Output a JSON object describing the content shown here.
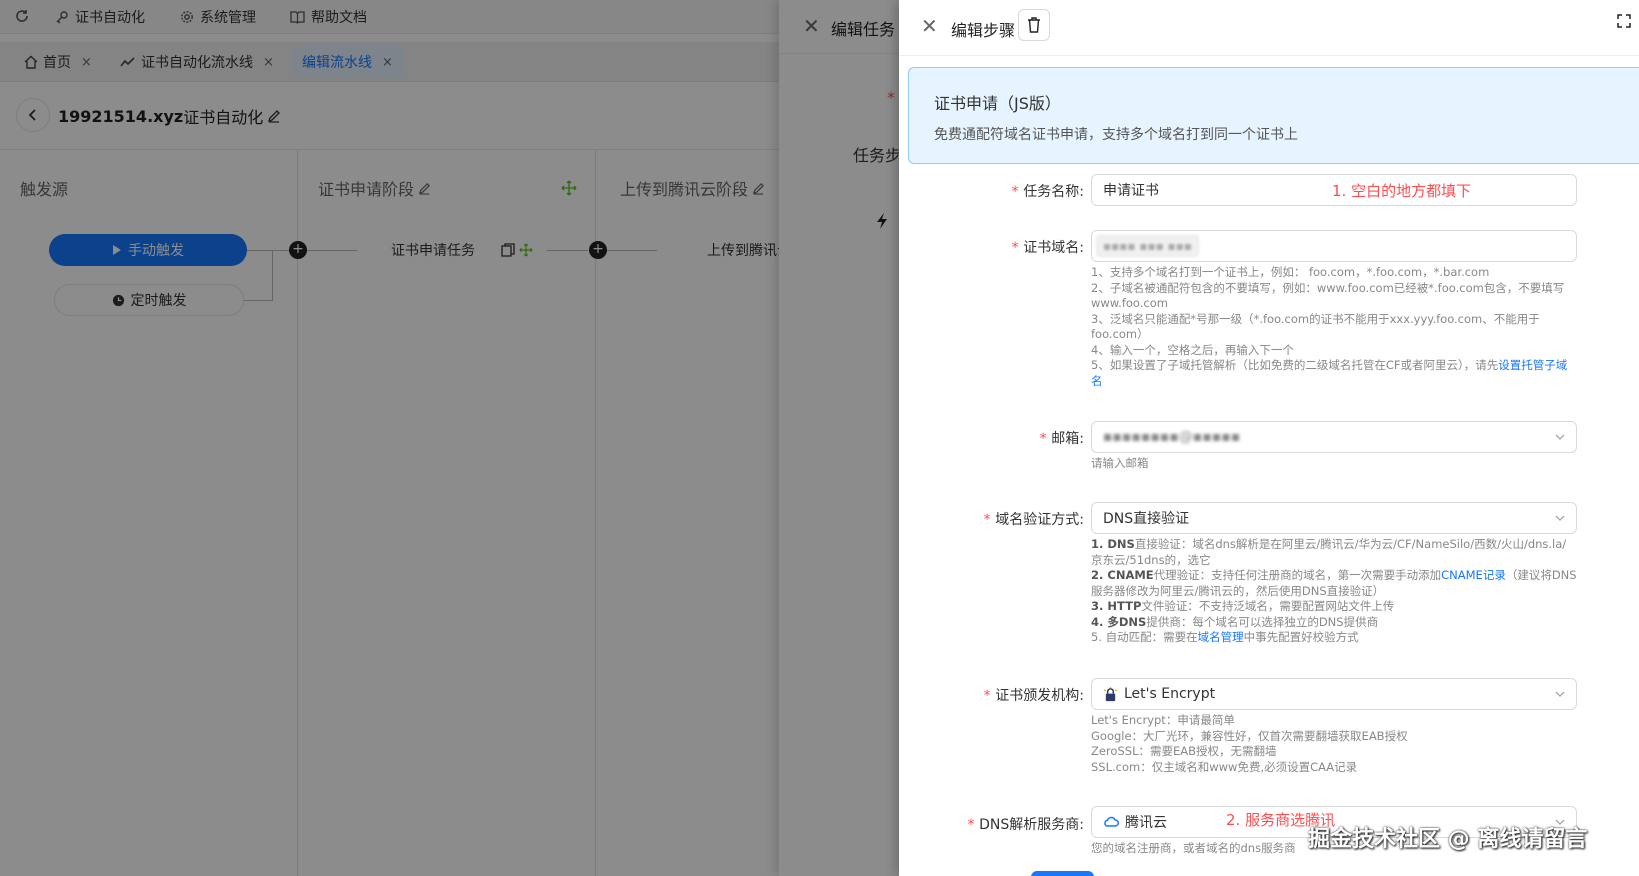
{
  "topnav": {
    "items": [
      {
        "label": "证书自动化",
        "icon": "key-icon"
      },
      {
        "label": "系统管理",
        "icon": "gear-icon"
      },
      {
        "label": "帮助文档",
        "icon": "book-icon"
      }
    ]
  },
  "tabs": [
    {
      "label": "首页",
      "close": "×"
    },
    {
      "label": "证书自动化流水线",
      "close": "×"
    },
    {
      "label": "编辑流水线",
      "close": "×"
    }
  ],
  "page": {
    "title_id": "19921514.xyz",
    "title_suffix": "证书自动化"
  },
  "pipeline": {
    "stages": [
      {
        "title": "触发源"
      },
      {
        "title": "证书申请阶段"
      },
      {
        "title": "上传到腾讯云阶段"
      }
    ],
    "triggers": {
      "manual": "手动触发",
      "scheduled": "定时触发"
    },
    "tasks": {
      "cert_task": "证书申请任务",
      "upload_task": "上传到腾讯云"
    }
  },
  "drawer_task": {
    "title": "编辑任务",
    "label": "任务步",
    "star": "*"
  },
  "drawer_step": {
    "title": "编辑步骤",
    "plugin": {
      "title": "证书申请（JS版）",
      "description": "免费通配符域名证书申请，支持多个域名打到同一个证书上"
    },
    "fields": {
      "task_name": {
        "label": "任务名称:",
        "value": "申请证书",
        "annotation": "1. 空白的地方都填下"
      },
      "domains": {
        "label": "证书域名:",
        "value": "▪▪▪▪ ▪▪▪ ▪▪▪",
        "help": [
          "1、支持多个域名打到一个证书上，例如： foo.com，*.foo.com，*.bar.com",
          "2、子域名被通配符包含的不要填写，例如：www.foo.com已经被*.foo.com包含，不要填写www.foo.com",
          "3、泛域名只能通配*号那一级（*.foo.com的证书不能用于xxx.yyy.foo.com、不能用于foo.com）",
          "4、输入一个，空格之后，再输入下一个"
        ],
        "help5_prefix": "5、如果设置了子域托管解析（比如免费的二级域名托管在CF或者阿里云），请先",
        "help5_link": "设置托管子域名"
      },
      "email": {
        "label": "邮箱:",
        "value": "▪▪▪▪▪▪▪▪@▪▪▪▪▪",
        "help": "请输入邮箱"
      },
      "verify": {
        "label": "域名验证方式:",
        "value": "DNS直接验证",
        "help": [
          {
            "b": "1. DNS",
            "t": "直接验证：域名dns解析是在阿里云/腾讯云/华为云/CF/NameSilo/西数/火山/dns.la/京东云/51dns的，选它"
          },
          {
            "b": "2. CNAME",
            "t": "代理验证：支持任何注册商的域名，第一次需要手动添加",
            "link": "CNAME记录",
            "t2": "（建议将DNS服务器修改为阿里云/腾讯云的，然后使用DNS直接验证）"
          },
          {
            "b": "3. HTTP",
            "t": "文件验证：不支持泛域名，需要配置网站文件上传"
          },
          {
            "b": "4. 多DNS",
            "t": "提供商：每个域名可以选择独立的DNS提供商"
          },
          {
            "b": "",
            "t": "5. 自动匹配：需要在",
            "link": "域名管理",
            "t2": "中事先配置好校验方式"
          }
        ]
      },
      "issuer": {
        "label": "证书颁发机构:",
        "value": "Let's Encrypt",
        "help": [
          "Let's Encrypt：申请最简单",
          "Google：大厂光环，兼容性好，仅首次需要翻墙获取EAB授权",
          "ZeroSSL：需要EAB授权，无需翻墙",
          "SSL.com：仅主域名和www免费,必须设置CAA记录"
        ]
      },
      "dns_provider": {
        "label": "DNS解析服务商:",
        "value": "腾讯云",
        "annotation": "2. 服务商选腾讯",
        "help": "您的域名注册商，或者域名的dns服务商"
      }
    }
  },
  "watermark": "掘金技术社区 @ 离线请留言",
  "colors": {
    "primary": "#1677ff",
    "required": "#ff4d4f",
    "plugin_bg": "#e6f4ff"
  }
}
